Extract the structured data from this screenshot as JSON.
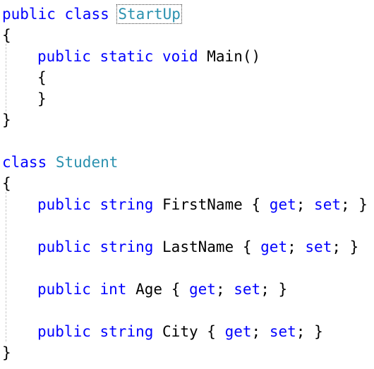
{
  "code": {
    "l1": {
      "kw1": "public",
      "kw2": "class",
      "name": "StartUp"
    },
    "l2": {
      "brace": "{"
    },
    "l3": {
      "kw1": "public",
      "kw2": "static",
      "kw3": "void",
      "rest": "Main()"
    },
    "l4": {
      "brace": "{"
    },
    "l5": {
      "brace": "}"
    },
    "l6": {
      "brace": "}"
    },
    "l8": {
      "kw1": "class",
      "name": "Student"
    },
    "l9": {
      "brace": "{"
    },
    "l10": {
      "kw1": "public",
      "type": "string",
      "name": "FirstName",
      "open": "{",
      "get": "get",
      "sep1": ";",
      "set": "set",
      "sep2": ";",
      "close": "}"
    },
    "l12": {
      "kw1": "public",
      "type": "string",
      "name": "LastName",
      "open": "{",
      "get": "get",
      "sep1": ";",
      "set": "set",
      "sep2": ";",
      "close": "}"
    },
    "l14": {
      "kw1": "public",
      "type": "int",
      "name": "Age",
      "open": "{",
      "get": "get",
      "sep1": ";",
      "set": "set",
      "sep2": ";",
      "close": "}"
    },
    "l16": {
      "kw1": "public",
      "type": "string",
      "name": "City",
      "open": "{",
      "get": "get",
      "sep1": ";",
      "set": "set",
      "sep2": ";",
      "close": "}"
    },
    "l17": {
      "brace": "}"
    }
  },
  "colors": {
    "keyword": "#0000ff",
    "type_name": "#2b91af",
    "plain_text": "#000000",
    "indent_guide": "#c8c8c8"
  }
}
